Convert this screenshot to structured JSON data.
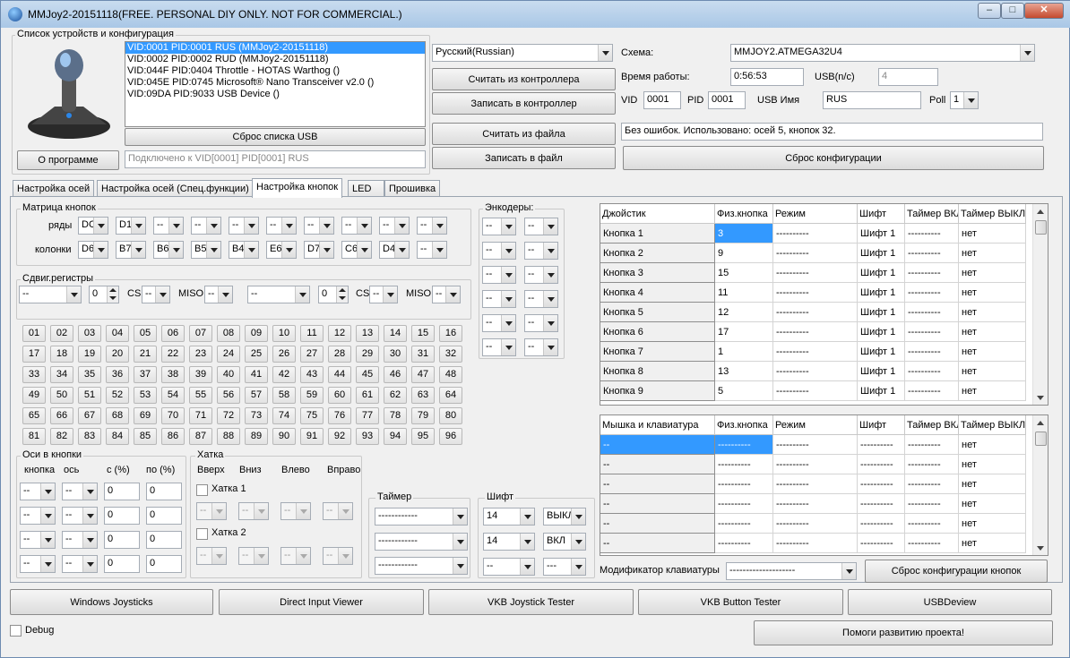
{
  "window": {
    "title": "MMJoy2-20151118(FREE. PERSONAL DIY ONLY. NOT FOR COMMERCIAL.)",
    "min": "‒",
    "max": "□",
    "close": "✕"
  },
  "devices": {
    "group_title": "Список устройств и конфигурация",
    "list": [
      "VID:0001 PID:0001 RUS (MMJoy2-20151118)",
      "VID:0002 PID:0002 RUD (MMJoy2-20151118)",
      "VID:044F PID:0404 Throttle - HOTAS Warthog ()",
      "VID:045E PID:0745 Microsoft® Nano Transceiver v2.0 ()",
      "VID:09DA PID:9033 USB Device ()"
    ],
    "reset_usb": "Сброс списка USB",
    "about": "О программе",
    "connected": "Подключено к VID[0001] PID[0001] RUS"
  },
  "actions": {
    "language": "Русский(Russian)",
    "read_controller": "Считать из контроллера",
    "write_controller": "Записать в контроллер",
    "read_file": "Считать из файла",
    "write_file": "Записать в файл"
  },
  "config": {
    "scheme_label": "Схема:",
    "scheme_value": "MMJOY2.ATMEGA32U4",
    "uptime_label": "Время работы:",
    "uptime_value": "0:56:53",
    "usb_nc_label": "USB(n/c)",
    "usb_nc_value": "4",
    "vid_label": "VID",
    "vid_value": "0001",
    "pid_label": "PID",
    "pid_value": "0001",
    "usb_name_label": "USB Имя",
    "usb_name_value": "RUS",
    "poll_label": "Poll",
    "poll_value": "1",
    "status": "Без ошибок. Использовано: осей  5, кнопок  32.",
    "reset_config": "Сброс конфигурации"
  },
  "tabs": [
    "Настройка осей",
    "Настройка осей (Спец.функции)",
    "Настройка кнопок",
    "LED",
    "Прошивка"
  ],
  "matrix": {
    "title": "Матрица кнопок",
    "rows_label": "ряды",
    "cols_label": "колонки",
    "rows": [
      "DC",
      "D1",
      "--",
      "--",
      "--",
      "--",
      "--",
      "--",
      "--",
      "--"
    ],
    "cols": [
      "D6",
      "B7",
      "B6",
      "B5",
      "B4",
      "E6",
      "D7",
      "C6",
      "D4",
      "--"
    ]
  },
  "shift_regs": {
    "title": "Сдвиг.регистры",
    "r1": {
      "port": "--",
      "count": "0",
      "cs_label": "CS",
      "cs": "--",
      "miso_label": "MISO",
      "miso": "--"
    },
    "r2": {
      "port": "--",
      "count": "0",
      "cs_label": "CS",
      "cs": "--",
      "miso_label": "MISO",
      "miso": "--"
    }
  },
  "encoders": {
    "title": "Энкодеры:",
    "rows": [
      [
        "--",
        "--"
      ],
      [
        "--",
        "--"
      ],
      [
        "--",
        "--"
      ],
      [
        "--",
        "--"
      ],
      [
        "--",
        "--"
      ],
      [
        "--",
        "--"
      ]
    ]
  },
  "buttons": [
    "01",
    "02",
    "03",
    "04",
    "05",
    "06",
    "07",
    "08",
    "09",
    "10",
    "11",
    "12",
    "13",
    "14",
    "15",
    "16",
    "17",
    "18",
    "19",
    "20",
    "21",
    "22",
    "23",
    "24",
    "25",
    "26",
    "27",
    "28",
    "29",
    "30",
    "31",
    "32",
    "33",
    "34",
    "35",
    "36",
    "37",
    "38",
    "39",
    "40",
    "41",
    "42",
    "43",
    "44",
    "45",
    "46",
    "47",
    "48",
    "49",
    "50",
    "51",
    "52",
    "53",
    "54",
    "55",
    "56",
    "57",
    "58",
    "59",
    "60",
    "61",
    "62",
    "63",
    "64",
    "65",
    "66",
    "67",
    "68",
    "69",
    "70",
    "71",
    "72",
    "73",
    "74",
    "75",
    "76",
    "77",
    "78",
    "79",
    "80",
    "81",
    "82",
    "83",
    "84",
    "85",
    "86",
    "87",
    "88",
    "89",
    "90",
    "91",
    "92",
    "93",
    "94",
    "95",
    "96"
  ],
  "axes_to_buttons": {
    "title": "Оси в кнопки",
    "h_button": "кнопка",
    "h_axis": "ось",
    "h_from": "с (%)",
    "h_to": "по (%)",
    "rows": [
      [
        "--",
        "--",
        "0",
        "0"
      ],
      [
        "--",
        "--",
        "0",
        "0"
      ],
      [
        "--",
        "--",
        "0",
        "0"
      ],
      [
        "--",
        "--",
        "0",
        "0"
      ]
    ]
  },
  "hat": {
    "title": "Хатка",
    "up": "Вверх",
    "down": "Вниз",
    "left": "Влево",
    "right": "Вправо",
    "hat1": "Хатка 1",
    "hat2": "Хатка 2",
    "val": "--"
  },
  "timer": {
    "title": "Таймер",
    "values": [
      "------------",
      "------------",
      "------------"
    ]
  },
  "shift": {
    "title": "Шифт",
    "rows": [
      [
        "14",
        "ВЫКЛ"
      ],
      [
        "14",
        "ВКЛ"
      ],
      [
        "--",
        "---"
      ]
    ]
  },
  "joystick_table": {
    "headers": [
      "Джойстик",
      "Физ.кнопка",
      "Режим",
      "Шифт",
      "Таймер ВКЛ",
      "Таймер ВЫКЛ"
    ],
    "rows": [
      [
        "Кнопка 1",
        "3",
        "----------",
        "Шифт 1",
        "----------",
        "нет"
      ],
      [
        "Кнопка 2",
        "9",
        "----------",
        "Шифт 1",
        "----------",
        "нет"
      ],
      [
        "Кнопка 3",
        "15",
        "----------",
        "Шифт 1",
        "----------",
        "нет"
      ],
      [
        "Кнопка 4",
        "11",
        "----------",
        "Шифт 1",
        "----------",
        "нет"
      ],
      [
        "Кнопка 5",
        "12",
        "----------",
        "Шифт 1",
        "----------",
        "нет"
      ],
      [
        "Кнопка 6",
        "17",
        "----------",
        "Шифт 1",
        "----------",
        "нет"
      ],
      [
        "Кнопка 7",
        "1",
        "----------",
        "Шифт 1",
        "----------",
        "нет"
      ],
      [
        "Кнопка 8",
        "13",
        "----------",
        "Шифт 1",
        "----------",
        "нет"
      ],
      [
        "Кнопка 9",
        "5",
        "----------",
        "Шифт 1",
        "----------",
        "нет"
      ]
    ]
  },
  "mouse_table": {
    "headers": [
      "Мышка и клавиатура",
      "Физ.кнопка",
      "Режим",
      "Шифт",
      "Таймер ВКЛ",
      "Таймер ВЫКЛ"
    ],
    "rows": [
      [
        "--",
        "----------",
        "----------",
        "----------",
        "----------",
        "нет"
      ],
      [
        "--",
        "----------",
        "----------",
        "----------",
        "----------",
        "нет"
      ],
      [
        "--",
        "----------",
        "----------",
        "----------",
        "----------",
        "нет"
      ],
      [
        "--",
        "----------",
        "----------",
        "----------",
        "----------",
        "нет"
      ],
      [
        "--",
        "----------",
        "----------",
        "----------",
        "----------",
        "нет"
      ],
      [
        "--",
        "----------",
        "----------",
        "----------",
        "----------",
        "нет"
      ]
    ]
  },
  "modifier": {
    "label": "Модификатор клавиатуры",
    "value": "--------------------",
    "reset": "Сброс конфигурации кнопок"
  },
  "bottom": {
    "buttons": [
      "Windows Joysticks",
      "Direct Input Viewer",
      "VKB Joystick Tester",
      "VKB Button Tester",
      "USBDeview"
    ],
    "debug": "Debug",
    "help": "Помоги развитию проекта!"
  }
}
